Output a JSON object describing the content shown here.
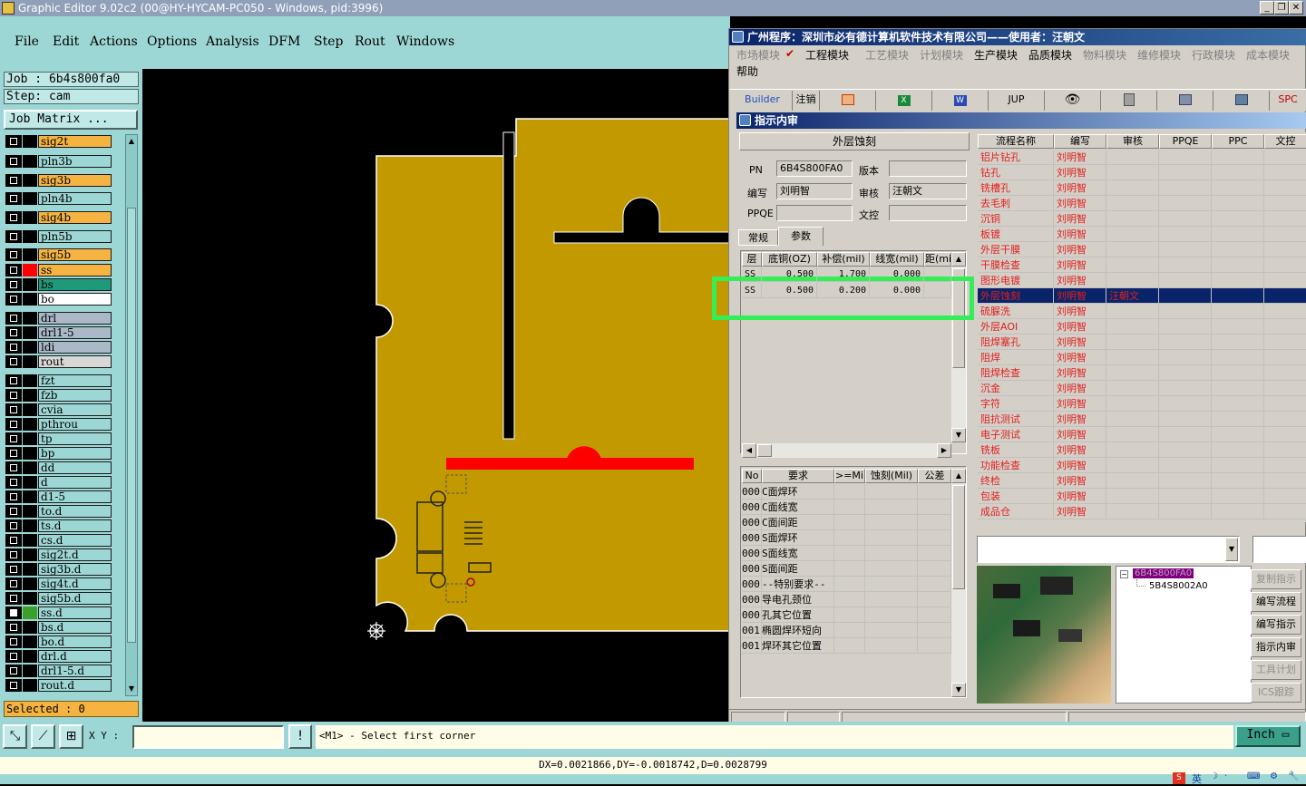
{
  "window": {
    "title": "Graphic Editor 9.02c2 (00@HY-HYCAM-PC050 - Windows, pid:3996)"
  },
  "menu": [
    "File",
    "Edit",
    "Actions",
    "Options",
    "Analysis",
    "DFM",
    "Step",
    "Rout",
    "Windows"
  ],
  "left": {
    "job_label": "Job : 6b4s800fa0",
    "step_label": "Step: cam",
    "job_matrix": "Job Matrix ...",
    "selected": "Selected : 0",
    "layers": [
      {
        "name": "sig2t",
        "color": "#f5b442",
        "swatch": "#000"
      },
      {
        "name": "pln3b",
        "color": "#9dd7d5",
        "swatch": "#000"
      },
      {
        "name": "sig3b",
        "color": "#f5b442",
        "swatch": "#000"
      },
      {
        "name": "pln4b",
        "color": "#9dd7d5",
        "swatch": "#000"
      },
      {
        "name": "sig4b",
        "color": "#f5b442",
        "swatch": "#000"
      },
      {
        "name": "pln5b",
        "color": "#9dd7d5",
        "swatch": "#000"
      },
      {
        "name": "sig5b",
        "color": "#f5b442",
        "swatch": "#000"
      },
      {
        "name": "ss",
        "color": "#f5b442",
        "swatch": "#ff0000"
      },
      {
        "name": "bs",
        "color": "#1e9a7a",
        "swatch": "#000"
      },
      {
        "name": "bo",
        "color": "#ffffff",
        "swatch": "#000"
      },
      {
        "name": "drl",
        "color": "#aab8c8",
        "swatch": "#000"
      },
      {
        "name": "drl1-5",
        "color": "#aab8c8",
        "swatch": "#000"
      },
      {
        "name": "ldi",
        "color": "#aab8c8",
        "swatch": "#000"
      },
      {
        "name": "rout",
        "color": "#d8d8d8",
        "swatch": "#000"
      },
      {
        "name": "fzt",
        "color": "#9dd7d5",
        "swatch": "#000"
      },
      {
        "name": "fzb",
        "color": "#9dd7d5",
        "swatch": "#000"
      },
      {
        "name": "cvia",
        "color": "#9dd7d5",
        "swatch": "#000"
      },
      {
        "name": "pthrou",
        "color": "#9dd7d5",
        "swatch": "#000"
      },
      {
        "name": "tp",
        "color": "#9dd7d5",
        "swatch": "#000"
      },
      {
        "name": "bp",
        "color": "#9dd7d5",
        "swatch": "#000"
      },
      {
        "name": "dd",
        "color": "#9dd7d5",
        "swatch": "#000"
      },
      {
        "name": "d",
        "color": "#9dd7d5",
        "swatch": "#000"
      },
      {
        "name": "d1-5",
        "color": "#9dd7d5",
        "swatch": "#000"
      },
      {
        "name": "to.d",
        "color": "#9dd7d5",
        "swatch": "#000"
      },
      {
        "name": "ts.d",
        "color": "#9dd7d5",
        "swatch": "#000"
      },
      {
        "name": "cs.d",
        "color": "#9dd7d5",
        "swatch": "#000"
      },
      {
        "name": "sig2t.d",
        "color": "#9dd7d5",
        "swatch": "#000"
      },
      {
        "name": "sig3b.d",
        "color": "#9dd7d5",
        "swatch": "#000"
      },
      {
        "name": "sig4t.d",
        "color": "#9dd7d5",
        "swatch": "#000"
      },
      {
        "name": "sig5b.d",
        "color": "#9dd7d5",
        "swatch": "#000"
      },
      {
        "name": "ss.d",
        "color": "#9dd7d5",
        "swatch": "#3aa02a"
      },
      {
        "name": "bs.d",
        "color": "#9dd7d5",
        "swatch": "#000"
      },
      {
        "name": "bo.d",
        "color": "#9dd7d5",
        "swatch": "#000"
      },
      {
        "name": "drl.d",
        "color": "#9dd7d5",
        "swatch": "#000"
      },
      {
        "name": "drl1-5.d",
        "color": "#9dd7d5",
        "swatch": "#000"
      },
      {
        "name": "rout.d",
        "color": "#9dd7d5",
        "swatch": "#000"
      }
    ]
  },
  "bottom": {
    "xy_label": "X Y :",
    "xy_value": "",
    "message": "<M1> - Select first corner",
    "unit": "Inch",
    "status": "DX=0.0021866,DY=-0.0018742,D=0.0028799"
  },
  "erp": {
    "title": "广州程序：深圳市必有德计算机软件技术有限公司——使用者：汪朝文",
    "modules": [
      "市场模块",
      "工程模块",
      "工艺模块",
      "计划模块",
      "生产模块",
      "品质模块",
      "物料模块",
      "维修模块",
      "行政模块",
      "成本模块"
    ],
    "help": "帮助",
    "toolbar": {
      "builder": "Builder",
      "logout": "注销",
      "jup": "JUP",
      "spc": "SPC"
    },
    "subwindow_title": "指示内审",
    "form": {
      "process_name": "外层蚀刻",
      "pn_label": "PN",
      "pn_value": "6B4S800FA0",
      "version_label": "版本",
      "version_value": "",
      "writer_label": "编写",
      "writer_value": "刘明智",
      "reviewer_label": "审核",
      "reviewer_value": "汪朝文",
      "ppqe_label": "PPQE",
      "ppqe_value": "",
      "doc_label": "文控",
      "doc_value": ""
    },
    "tabs": [
      "常规",
      "参数"
    ],
    "param_headers": [
      "层",
      "底铜(OZ)",
      "补偿(mil)",
      "线宽(mil)",
      "距(mi"
    ],
    "param_rows": [
      [
        "SS",
        "0.500",
        "1.700",
        "0.000",
        ""
      ],
      [
        "SS",
        "0.500",
        "0.200",
        "0.000",
        ""
      ]
    ],
    "req_headers": [
      "No",
      "要求",
      ">=Mil",
      "蚀刻(Mil)",
      "公差"
    ],
    "req_rows": [
      [
        "000",
        "C面焊环"
      ],
      [
        "000",
        "C面线宽"
      ],
      [
        "000",
        "C面间距"
      ],
      [
        "000",
        "S面焊环"
      ],
      [
        "000",
        "S面线宽"
      ],
      [
        "000",
        "S面间距"
      ],
      [
        "000",
        "--特别要求--"
      ],
      [
        "000",
        "导电孔颈位"
      ],
      [
        "000",
        "孔其它位置"
      ],
      [
        "001",
        "椭圆焊环短向"
      ],
      [
        "001",
        "焊环其它位置"
      ]
    ],
    "flow_headers": [
      "流程名称",
      "编写",
      "审核",
      "PPQE",
      "PPC",
      "文控"
    ],
    "flow_rows": [
      [
        "铝片钻孔",
        "刘明智",
        ""
      ],
      [
        "钻孔",
        "刘明智",
        ""
      ],
      [
        "铣槽孔",
        "刘明智",
        ""
      ],
      [
        "去毛刺",
        "刘明智",
        ""
      ],
      [
        "沉铜",
        "刘明智",
        ""
      ],
      [
        "板镀",
        "刘明智",
        ""
      ],
      [
        "外层干膜",
        "刘明智",
        ""
      ],
      [
        "干膜检查",
        "刘明智",
        ""
      ],
      [
        "图形电镀",
        "刘明智",
        ""
      ],
      [
        "外层蚀刻",
        "刘明智",
        "汪朝文"
      ],
      [
        "硫脲洗",
        "刘明智",
        ""
      ],
      [
        "外层AOI",
        "刘明智",
        ""
      ],
      [
        "阻焊塞孔",
        "刘明智",
        ""
      ],
      [
        "阻焊",
        "刘明智",
        ""
      ],
      [
        "阻焊检查",
        "刘明智",
        ""
      ],
      [
        "沉金",
        "刘明智",
        ""
      ],
      [
        "字符",
        "刘明智",
        ""
      ],
      [
        "阻抗测试",
        "刘明智",
        ""
      ],
      [
        "电子测试",
        "刘明智",
        ""
      ],
      [
        "铣板",
        "刘明智",
        ""
      ],
      [
        "功能检查",
        "刘明智",
        ""
      ],
      [
        "终检",
        "刘明智",
        ""
      ],
      [
        "包装",
        "刘明智",
        ""
      ],
      [
        "成品仓",
        "刘明智",
        ""
      ]
    ],
    "selected_flow_index": 9,
    "tree": {
      "root": "6B4S800FA0",
      "child": "5B4S8002A0"
    },
    "side_buttons": [
      {
        "label": "复制指示",
        "enabled": false
      },
      {
        "label": "编写流程",
        "enabled": true
      },
      {
        "label": "编写指示",
        "enabled": true
      },
      {
        "label": "指示内审",
        "enabled": true
      },
      {
        "label": "工具计划",
        "enabled": false
      },
      {
        "label": "ICS跟踪",
        "enabled": false
      }
    ]
  },
  "tray": {
    "ime": "英"
  },
  "colors": {
    "copper": "#c29a00",
    "red_feature": "#ff0000",
    "highlight": "#33ee55",
    "selection": "#0a246a",
    "teal": "#9dd7d5"
  }
}
